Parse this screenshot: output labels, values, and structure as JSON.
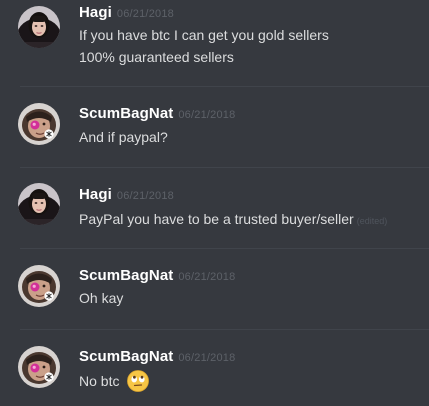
{
  "messages": [
    {
      "author": "Hagi",
      "avatar": "user-avatar-hagi",
      "timestamp": "06/21/2018",
      "lines": [
        "If you have btc I can get you gold sellers",
        "100% guaranteed sellers"
      ]
    },
    {
      "author": "ScumBagNat",
      "avatar": "user-avatar-scumbagnat",
      "timestamp": "06/21/2018",
      "lines": [
        "And if paypal?"
      ]
    },
    {
      "author": "Hagi",
      "avatar": "user-avatar-hagi",
      "timestamp": "06/21/2018",
      "lines": [
        "PayPal you have to be a trusted buyer/seller"
      ],
      "edited": "(edited)"
    },
    {
      "author": "ScumBagNat",
      "avatar": "user-avatar-scumbagnat",
      "timestamp": "06/21/2018",
      "lines": [
        "Oh kay"
      ]
    },
    {
      "author": "ScumBagNat",
      "avatar": "user-avatar-scumbagnat",
      "timestamp": "06/21/2018",
      "lines": [
        "No btc"
      ],
      "emoji": "face-with-rolling-eyes-emoji"
    }
  ],
  "colors": {
    "background": "#36393f",
    "username": "#ffffff",
    "message_text": "#dcddde",
    "timestamp": "#5d6168",
    "divider": "#40444b"
  }
}
